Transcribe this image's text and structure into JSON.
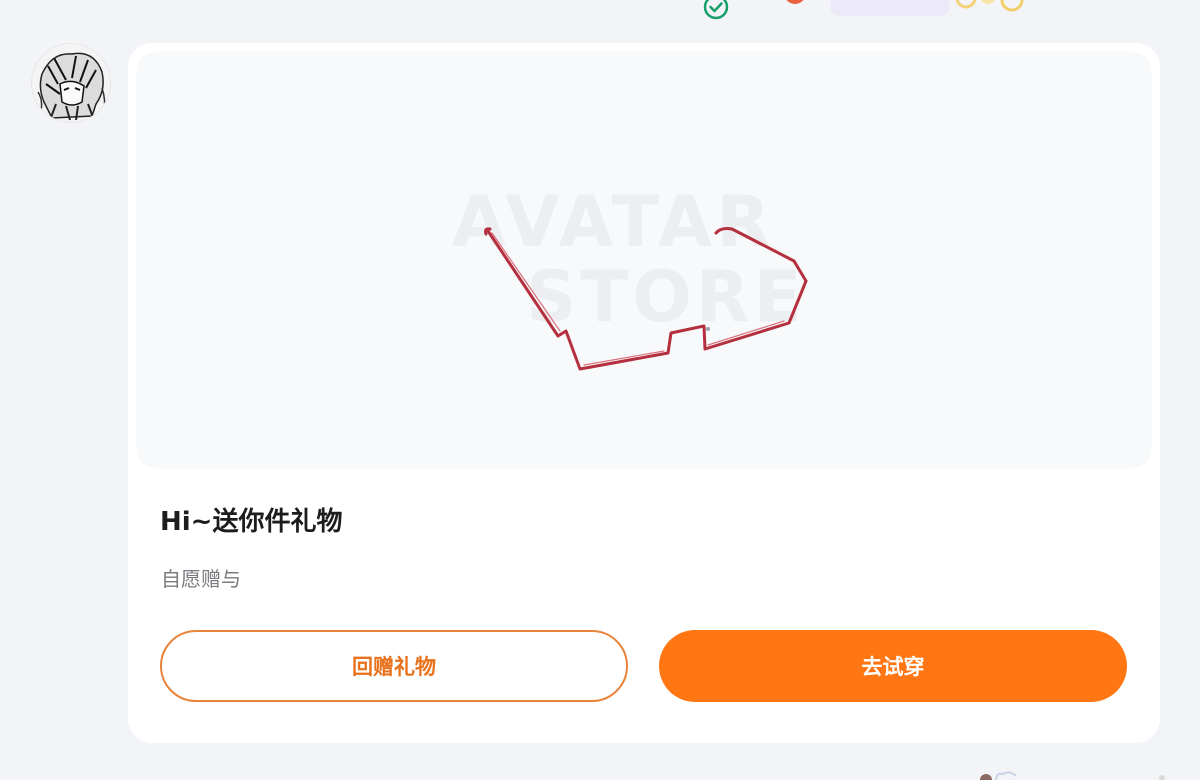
{
  "card": {
    "title": "Hi~送你件礼物",
    "subtitle": "自愿赠与",
    "return_gift_label": "回赠礼物",
    "try_on_label": "去试穿"
  },
  "preview": {
    "watermark_line1": "AVATAR",
    "watermark_line2": "STORE",
    "item_icon": "red-rimmed-glasses"
  },
  "colors": {
    "accent": "#ff7613",
    "accent_outline": "#e8833a",
    "background": "#f3f4f7",
    "card": "#ffffff",
    "glasses": "#b5303e",
    "check": "#18a06a"
  }
}
